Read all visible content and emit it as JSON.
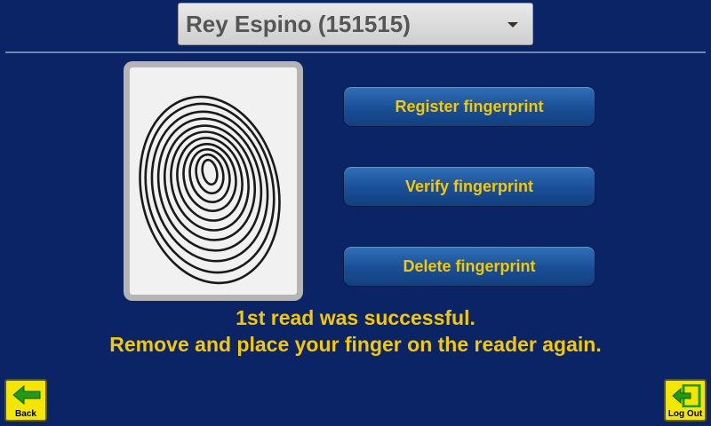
{
  "user_select": {
    "selected": "Rey Espino (151515)"
  },
  "actions": {
    "register": "Register fingerprint",
    "verify": "Verify fingerprint",
    "delete": "Delete fingerprint"
  },
  "status": {
    "line1": "1st read was successful.",
    "line2": "Remove and place your finger on the reader again."
  },
  "nav": {
    "back": "Back",
    "logout": "Log Out"
  },
  "colors": {
    "background": "#0b2466",
    "accent_text": "#f5c800",
    "nav_button": "#f5e600",
    "icon_green": "#1e9a1e"
  },
  "icons": {
    "back": "arrow-left-icon",
    "logout": "logout-icon",
    "dropdown": "chevron-down-icon",
    "fingerprint": "fingerprint-icon"
  }
}
